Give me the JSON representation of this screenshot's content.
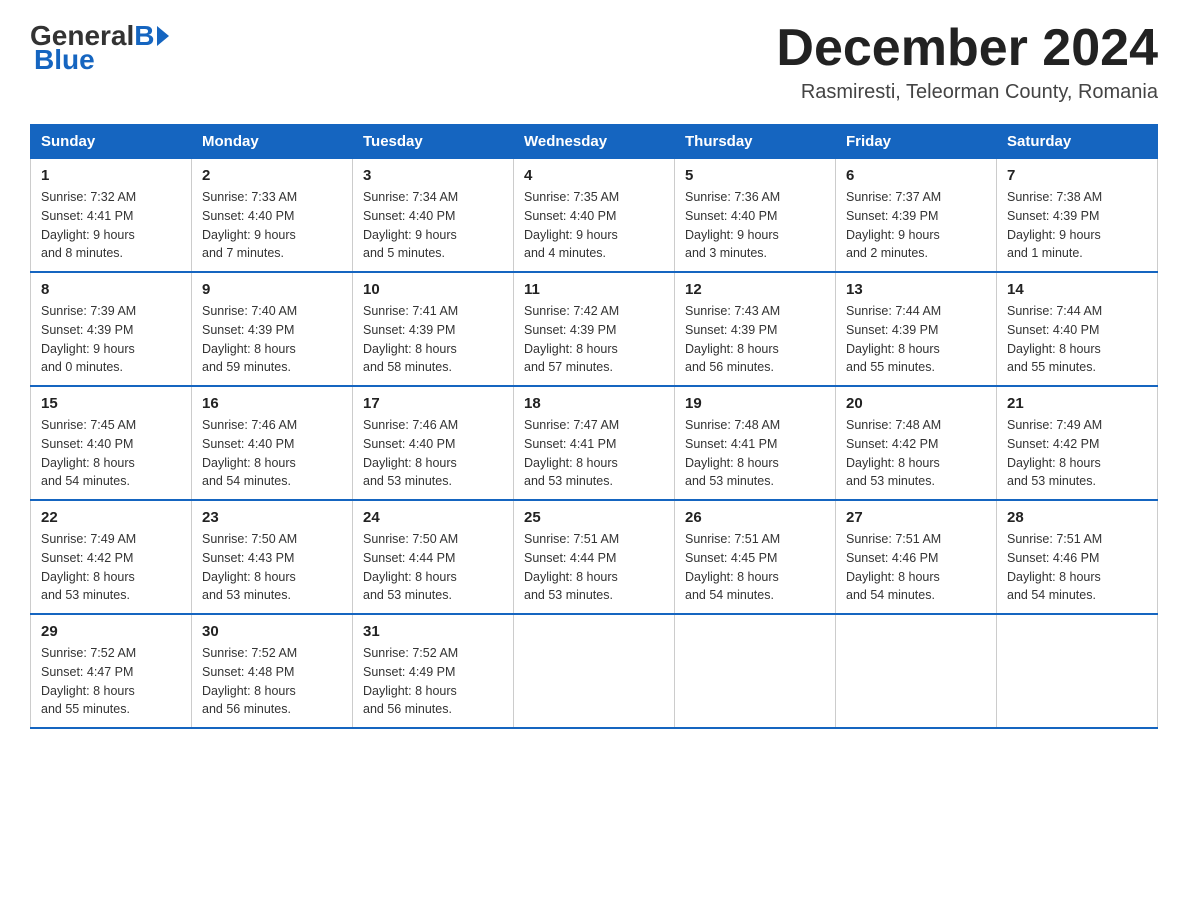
{
  "logo": {
    "general": "General",
    "blue": "Blue"
  },
  "title": {
    "month": "December 2024",
    "location": "Rasmiresti, Teleorman County, Romania"
  },
  "headers": [
    "Sunday",
    "Monday",
    "Tuesday",
    "Wednesday",
    "Thursday",
    "Friday",
    "Saturday"
  ],
  "weeks": [
    [
      {
        "day": "1",
        "sunrise": "7:32 AM",
        "sunset": "4:41 PM",
        "daylight": "9 hours and 8 minutes."
      },
      {
        "day": "2",
        "sunrise": "7:33 AM",
        "sunset": "4:40 PM",
        "daylight": "9 hours and 7 minutes."
      },
      {
        "day": "3",
        "sunrise": "7:34 AM",
        "sunset": "4:40 PM",
        "daylight": "9 hours and 5 minutes."
      },
      {
        "day": "4",
        "sunrise": "7:35 AM",
        "sunset": "4:40 PM",
        "daylight": "9 hours and 4 minutes."
      },
      {
        "day": "5",
        "sunrise": "7:36 AM",
        "sunset": "4:40 PM",
        "daylight": "9 hours and 3 minutes."
      },
      {
        "day": "6",
        "sunrise": "7:37 AM",
        "sunset": "4:39 PM",
        "daylight": "9 hours and 2 minutes."
      },
      {
        "day": "7",
        "sunrise": "7:38 AM",
        "sunset": "4:39 PM",
        "daylight": "9 hours and 1 minute."
      }
    ],
    [
      {
        "day": "8",
        "sunrise": "7:39 AM",
        "sunset": "4:39 PM",
        "daylight": "9 hours and 0 minutes."
      },
      {
        "day": "9",
        "sunrise": "7:40 AM",
        "sunset": "4:39 PM",
        "daylight": "8 hours and 59 minutes."
      },
      {
        "day": "10",
        "sunrise": "7:41 AM",
        "sunset": "4:39 PM",
        "daylight": "8 hours and 58 minutes."
      },
      {
        "day": "11",
        "sunrise": "7:42 AM",
        "sunset": "4:39 PM",
        "daylight": "8 hours and 57 minutes."
      },
      {
        "day": "12",
        "sunrise": "7:43 AM",
        "sunset": "4:39 PM",
        "daylight": "8 hours and 56 minutes."
      },
      {
        "day": "13",
        "sunrise": "7:44 AM",
        "sunset": "4:39 PM",
        "daylight": "8 hours and 55 minutes."
      },
      {
        "day": "14",
        "sunrise": "7:44 AM",
        "sunset": "4:40 PM",
        "daylight": "8 hours and 55 minutes."
      }
    ],
    [
      {
        "day": "15",
        "sunrise": "7:45 AM",
        "sunset": "4:40 PM",
        "daylight": "8 hours and 54 minutes."
      },
      {
        "day": "16",
        "sunrise": "7:46 AM",
        "sunset": "4:40 PM",
        "daylight": "8 hours and 54 minutes."
      },
      {
        "day": "17",
        "sunrise": "7:46 AM",
        "sunset": "4:40 PM",
        "daylight": "8 hours and 53 minutes."
      },
      {
        "day": "18",
        "sunrise": "7:47 AM",
        "sunset": "4:41 PM",
        "daylight": "8 hours and 53 minutes."
      },
      {
        "day": "19",
        "sunrise": "7:48 AM",
        "sunset": "4:41 PM",
        "daylight": "8 hours and 53 minutes."
      },
      {
        "day": "20",
        "sunrise": "7:48 AM",
        "sunset": "4:42 PM",
        "daylight": "8 hours and 53 minutes."
      },
      {
        "day": "21",
        "sunrise": "7:49 AM",
        "sunset": "4:42 PM",
        "daylight": "8 hours and 53 minutes."
      }
    ],
    [
      {
        "day": "22",
        "sunrise": "7:49 AM",
        "sunset": "4:42 PM",
        "daylight": "8 hours and 53 minutes."
      },
      {
        "day": "23",
        "sunrise": "7:50 AM",
        "sunset": "4:43 PM",
        "daylight": "8 hours and 53 minutes."
      },
      {
        "day": "24",
        "sunrise": "7:50 AM",
        "sunset": "4:44 PM",
        "daylight": "8 hours and 53 minutes."
      },
      {
        "day": "25",
        "sunrise": "7:51 AM",
        "sunset": "4:44 PM",
        "daylight": "8 hours and 53 minutes."
      },
      {
        "day": "26",
        "sunrise": "7:51 AM",
        "sunset": "4:45 PM",
        "daylight": "8 hours and 54 minutes."
      },
      {
        "day": "27",
        "sunrise": "7:51 AM",
        "sunset": "4:46 PM",
        "daylight": "8 hours and 54 minutes."
      },
      {
        "day": "28",
        "sunrise": "7:51 AM",
        "sunset": "4:46 PM",
        "daylight": "8 hours and 54 minutes."
      }
    ],
    [
      {
        "day": "29",
        "sunrise": "7:52 AM",
        "sunset": "4:47 PM",
        "daylight": "8 hours and 55 minutes."
      },
      {
        "day": "30",
        "sunrise": "7:52 AM",
        "sunset": "4:48 PM",
        "daylight": "8 hours and 56 minutes."
      },
      {
        "day": "31",
        "sunrise": "7:52 AM",
        "sunset": "4:49 PM",
        "daylight": "8 hours and 56 minutes."
      },
      null,
      null,
      null,
      null
    ]
  ]
}
